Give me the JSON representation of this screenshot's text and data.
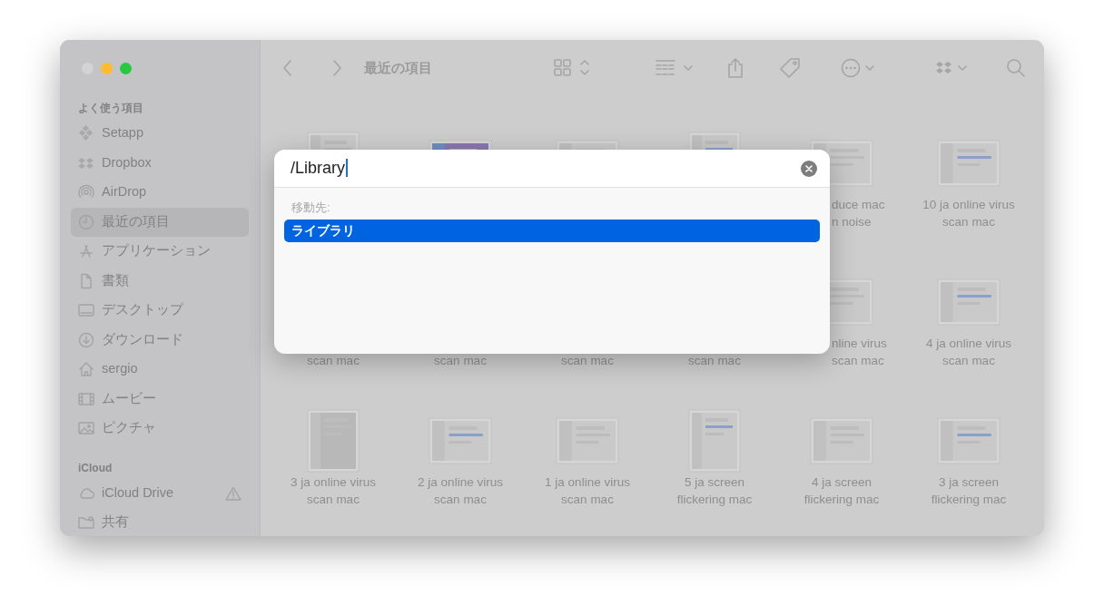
{
  "window": {
    "title": "最近の項目"
  },
  "sidebar": {
    "sections": [
      {
        "title": "よく使う項目",
        "items": [
          {
            "label": "Setapp",
            "selected": false
          },
          {
            "label": "Dropbox",
            "selected": false
          },
          {
            "label": "AirDrop",
            "selected": false
          },
          {
            "label": "最近の項目",
            "selected": true
          },
          {
            "label": "アプリケーション",
            "selected": false
          },
          {
            "label": "書類",
            "selected": false
          },
          {
            "label": "デスクトップ",
            "selected": false
          },
          {
            "label": "ダウンロード",
            "selected": false
          },
          {
            "label": "sergio",
            "selected": false
          },
          {
            "label": "ムービー",
            "selected": false
          },
          {
            "label": "ピクチャ",
            "selected": false
          }
        ]
      },
      {
        "title": "iCloud",
        "items": [
          {
            "label": "iCloud Drive",
            "selected": false,
            "warning": true
          },
          {
            "label": "共有",
            "selected": false
          }
        ]
      }
    ]
  },
  "files": [
    {
      "kind": "picture"
    },
    {
      "kind": "picture"
    },
    {
      "kind": "picture"
    },
    {
      "kind": "picture"
    },
    {
      "kind": "picture",
      "lines": [
        "duce mac",
        "n noise"
      ],
      "partially_hidden": true
    },
    {
      "kind": "picture",
      "lines": [
        "10 ja online virus",
        "scan mac"
      ]
    },
    {
      "lines": [
        "scan mac"
      ]
    },
    {
      "lines": [
        "scan mac"
      ]
    },
    {
      "lines": [
        "scan mac"
      ]
    },
    {
      "lines": [
        "scan mac"
      ]
    },
    {
      "kind": "picture",
      "lines": [
        "nline virus",
        "scan mac"
      ],
      "partially_hidden": true
    },
    {
      "kind": "picture",
      "lines": [
        "4 ja online virus",
        "scan mac"
      ]
    },
    {
      "kind": "picture",
      "lines": [
        "3 ja online virus",
        "scan mac"
      ]
    },
    {
      "kind": "picture",
      "lines": [
        "2 ja online virus",
        "scan mac"
      ]
    },
    {
      "kind": "picture",
      "lines": [
        "1 ja online virus",
        "scan mac"
      ]
    },
    {
      "kind": "picture",
      "lines": [
        "5 ja screen",
        "flickering mac"
      ]
    },
    {
      "kind": "picture",
      "lines": [
        "4 ja screen",
        "flickering mac"
      ]
    },
    {
      "kind": "picture",
      "lines": [
        "3 ja screen",
        "flickering mac"
      ]
    }
  ],
  "go_to_dialog": {
    "value": "/Library",
    "section_label": "移動先:",
    "results": [
      {
        "label": "ライブラリ",
        "selected": true
      }
    ]
  }
}
